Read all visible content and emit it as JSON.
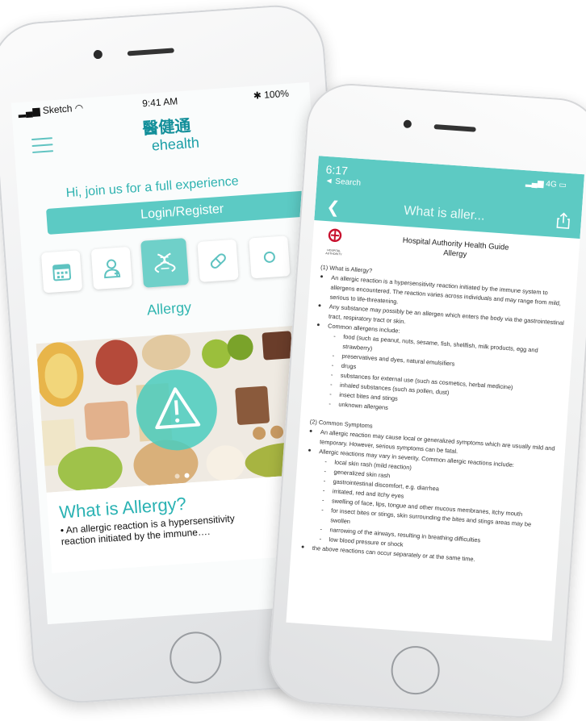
{
  "phone1": {
    "status": {
      "carrier": "Sketch",
      "time": "9:41 AM",
      "battery": "100%"
    },
    "logo": {
      "chinese": "醫健通",
      "english": "ehealth"
    },
    "greeting": "Hi, join us for a full experience",
    "login_label": "Login/Register",
    "categories": [
      {
        "icon": "calendar-icon"
      },
      {
        "icon": "doctor-icon"
      },
      {
        "icon": "dna-icon",
        "selected": true
      },
      {
        "icon": "pill-icon"
      },
      {
        "icon": "more-icon"
      }
    ],
    "selected_category": "Allergy",
    "carousel": {
      "active_index": 1,
      "count": 2
    },
    "article": {
      "title": "What is Allergy?",
      "body": "• An allergic reaction is a hypersensitivity reaction initiated by the immune…."
    }
  },
  "phone2": {
    "status": {
      "time": "6:17",
      "back_app": "◄ Search",
      "signal": "4G"
    },
    "nav_title": "What is aller...",
    "doc": {
      "org_logo_label": "HOSPITAL AUTHORITY",
      "header_line1": "Hospital Authority Health Guide",
      "header_line2": "Allergy",
      "s1_title": "(1)  What is Allergy?",
      "s1_b1": "An allergic reaction is a hypersensitivity reaction initiated by the immune system to allergens encountered. The reaction varies across individuals and may range from mild, serious to life-threatening.",
      "s1_b2": "Any substance may possibly be an allergen which enters the body via the gastrointestinal tract, respiratory tract or skin.",
      "s1_b3": "Common allergens include:",
      "allergens": [
        "food (such as peanut, nuts, sesame, fish, shellfish, milk products, egg and strawberry)",
        "preservatives and dyes, natural emulsifiers",
        "drugs",
        "substances for external use (such as cosmetics, herbal medicine)",
        "inhaled substances (such as pollen, dust)",
        "insect bites and stings",
        "unknown allergens"
      ],
      "s2_title": "(2)  Common Symptoms",
      "s2_b1": "An allergic reaction may cause local or generalized symptoms which are usually mild and temporary. However, serious symptoms can be fatal.",
      "s2_b2": "Allergic reactions may vary in severity. Common allergic reactions include:",
      "symptoms": [
        "local skin rash (mild reaction)",
        "generalized skin rash",
        "gastrointestinal discomfort, e.g. diarrhea",
        "irritated, red and itchy eyes",
        "swelling of face, lips, tongue and other mucous membranes, itchy mouth",
        "for insect bites or stings, skin surrounding the bites and stings areas may be swollen",
        "narrowing of the airways, resulting in breathing difficulties",
        "low blood pressure or shock"
      ],
      "s2_b3": "the above reactions can occur separately or at the same time."
    }
  },
  "colors": {
    "accent": "#5dcac3",
    "accent_text": "#2eb2b0",
    "logo": "#138f9a"
  }
}
